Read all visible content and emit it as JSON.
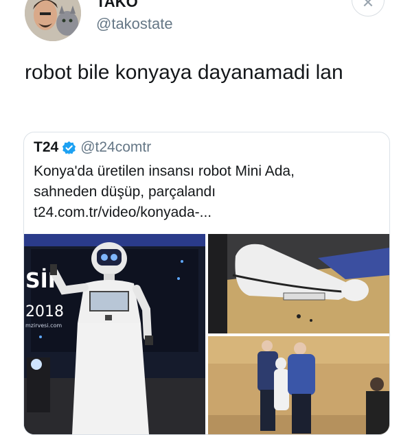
{
  "user": {
    "display_name": "TAKO",
    "handle": "@takostate"
  },
  "tweet": {
    "text": "robot bile konyaya dayanamadi lan"
  },
  "quoted": {
    "name": "T24",
    "handle": "@t24comtr",
    "text_lines": [
      "Konya'da üretilen insansı robot Mini Ada,",
      "sahneden düşüp, parçalandı",
      "t24.com.tr/video/konyada-..."
    ],
    "verified_color": "#1da1f2"
  },
  "media": {
    "stage_text_top": "SİI",
    "stage_text_year": "2018",
    "stage_text_small": "mzirvesi.com"
  },
  "colors": {
    "handle_gray": "#657786",
    "border": "#dbe1e7"
  }
}
